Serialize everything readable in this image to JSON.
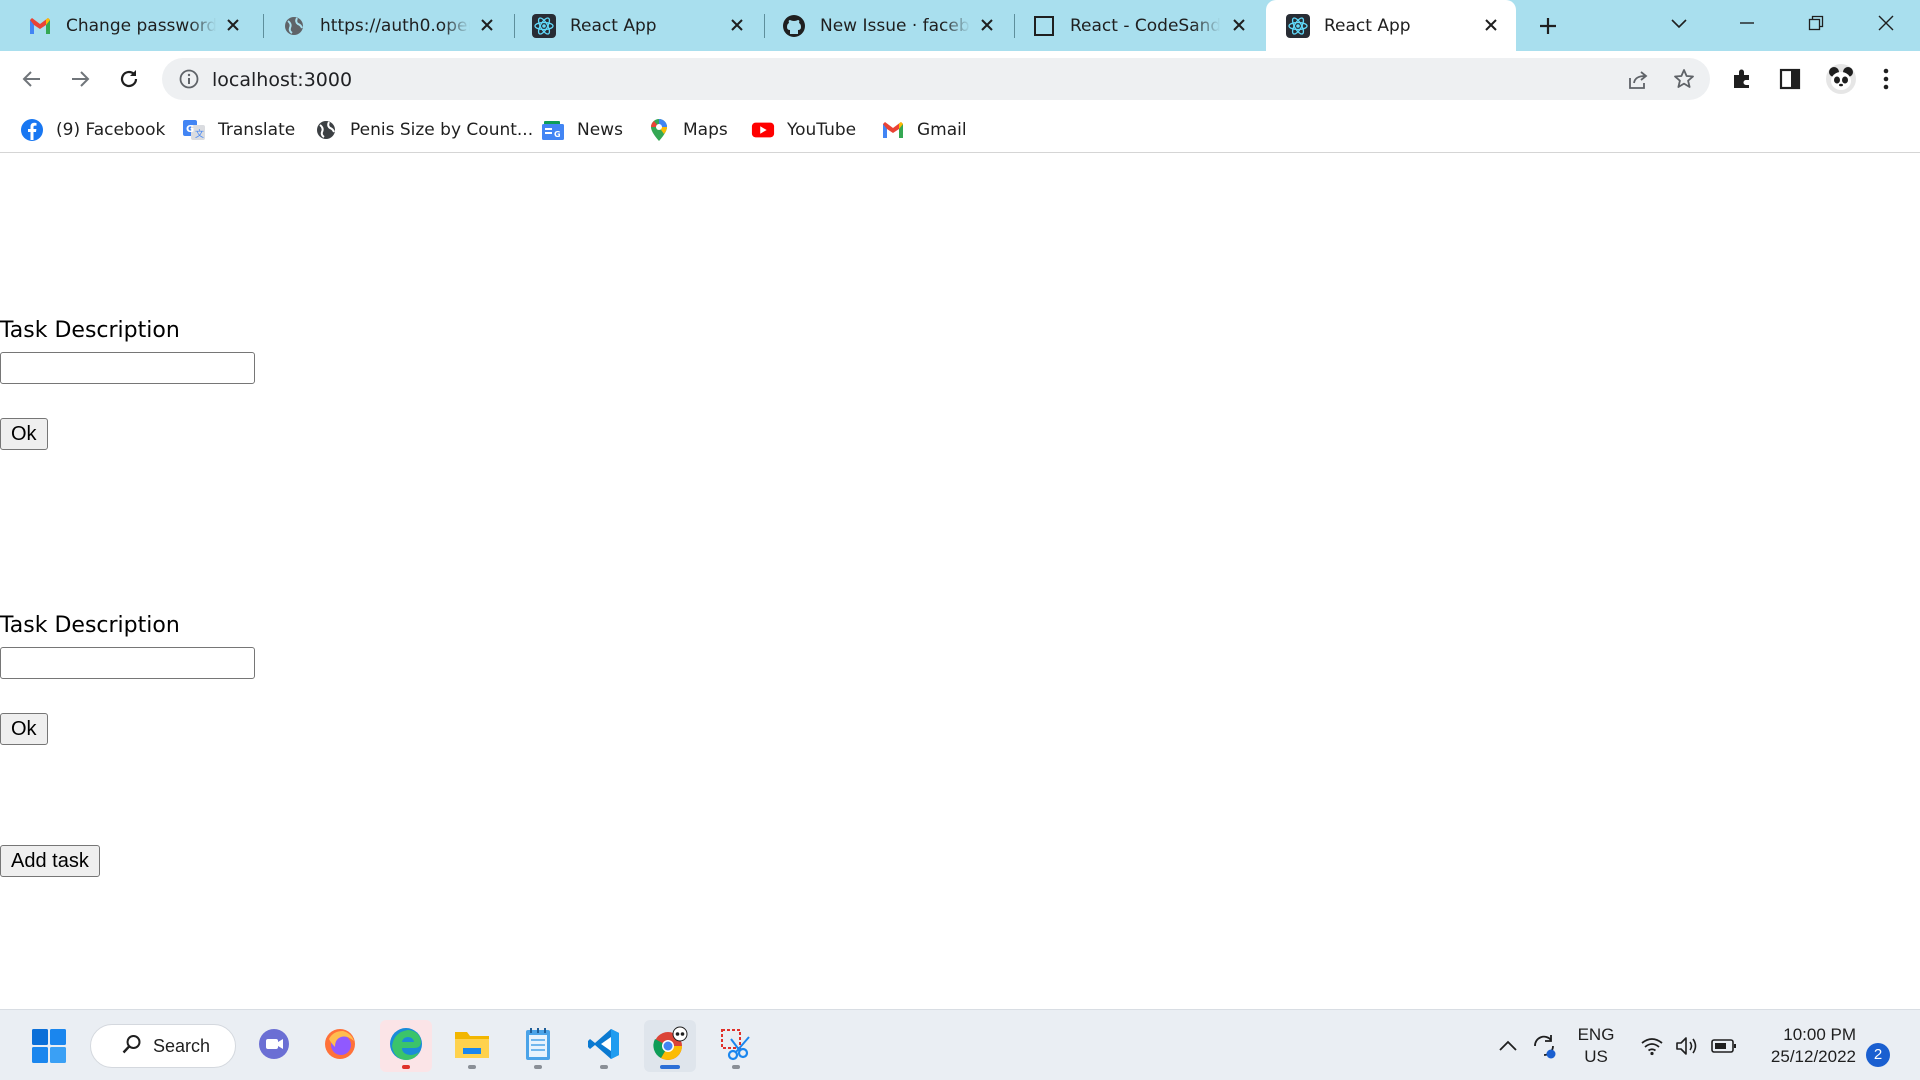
{
  "browser": {
    "tabs": [
      {
        "title": "Change password f",
        "icon": "gmail-icon",
        "active": false
      },
      {
        "title": "https://auth0.open",
        "icon": "globe-icon",
        "active": false
      },
      {
        "title": "React App",
        "icon": "react-icon",
        "active": false
      },
      {
        "title": "New Issue · facebo",
        "icon": "github-icon",
        "active": false
      },
      {
        "title": "React - CodeSandb",
        "icon": "codesandbox-icon",
        "active": false
      },
      {
        "title": "React App",
        "icon": "react-icon",
        "active": true
      }
    ],
    "url": "localhost:3000",
    "bookmarks": [
      {
        "label": "(9) Facebook",
        "icon": "facebook-icon"
      },
      {
        "label": "Translate",
        "icon": "translate-icon"
      },
      {
        "label": "Penis Size by Count...",
        "icon": "globe-icon"
      },
      {
        "label": "News",
        "icon": "news-icon"
      },
      {
        "label": "Maps",
        "icon": "maps-icon"
      },
      {
        "label": "YouTube",
        "icon": "youtube-icon"
      },
      {
        "label": "Gmail",
        "icon": "gmail-icon"
      }
    ]
  },
  "page": {
    "tasks": [
      {
        "label": "Task Description",
        "value": "",
        "ok_label": "Ok"
      },
      {
        "label": "Task Description",
        "value": "",
        "ok_label": "Ok"
      }
    ],
    "add_task_label": "Add task"
  },
  "taskbar": {
    "search_label": "Search",
    "apps": [
      "teams-icon",
      "firefox-icon",
      "edge-icon",
      "file-explorer-icon",
      "notepad-icon",
      "vscode-icon",
      "chrome-icon",
      "snipping-tool-icon"
    ],
    "lang_line1": "ENG",
    "lang_line2": "US",
    "time": "10:00 PM",
    "date": "25/12/2022",
    "notifications": "2"
  },
  "colors": {
    "tabstrip": "#a9dfee",
    "omnibox": "#eef0f2",
    "taskbar": "#eaeef3"
  }
}
